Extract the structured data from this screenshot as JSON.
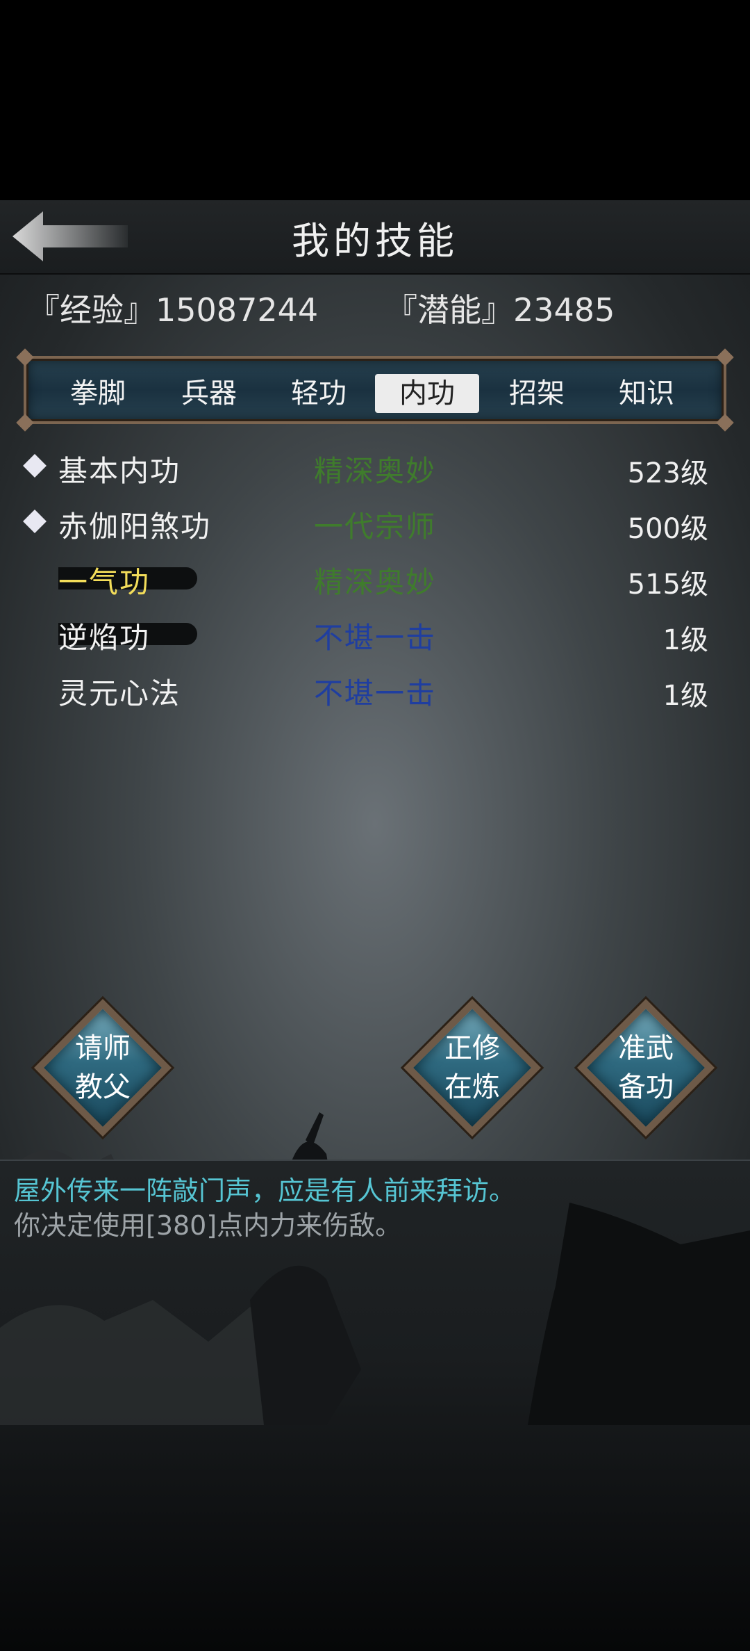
{
  "header": {
    "title": "我的技能",
    "back_icon": "back-arrow-icon"
  },
  "stats": {
    "experience": "『经验』15087244",
    "potential": "『潜能』23485"
  },
  "tabs": [
    {
      "label": "拳脚",
      "active": false
    },
    {
      "label": "兵器",
      "active": false
    },
    {
      "label": "轻功",
      "active": false
    },
    {
      "label": "内功",
      "active": true
    },
    {
      "label": "招架",
      "active": false
    },
    {
      "label": "知识",
      "active": false
    }
  ],
  "skills": [
    {
      "name": "基本内功",
      "rank": "精深奥妙",
      "level": "523级",
      "rank_color": "#3f7c2c",
      "enabled": true
    },
    {
      "name": "赤伽阳煞功",
      "rank": "一代宗师",
      "level": "500级",
      "rank_color": "#3f7c2c",
      "enabled": true
    },
    {
      "name": "一气功",
      "rank": "精深奥妙",
      "level": "515级",
      "rank_color": "#3f7c2c",
      "enabled": false
    },
    {
      "name": "逆焰功",
      "rank": "不堪一击",
      "level": "1级",
      "rank_color": "#1f3ea0",
      "enabled": false
    },
    {
      "name": "灵元心法",
      "rank": "不堪一击",
      "level": "1级",
      "rank_color": "#1f3ea0",
      "enabled": false
    }
  ],
  "actions": {
    "ask_master": [
      "请师",
      "教父"
    ],
    "practice": [
      "正修",
      "在炼"
    ],
    "prepare": [
      "准武",
      "备功"
    ]
  },
  "log": {
    "line1": "屋外传来一阵敲门声，应是有人前来拜访。",
    "line2": "你决定使用[380]点内力来伤敌。"
  }
}
